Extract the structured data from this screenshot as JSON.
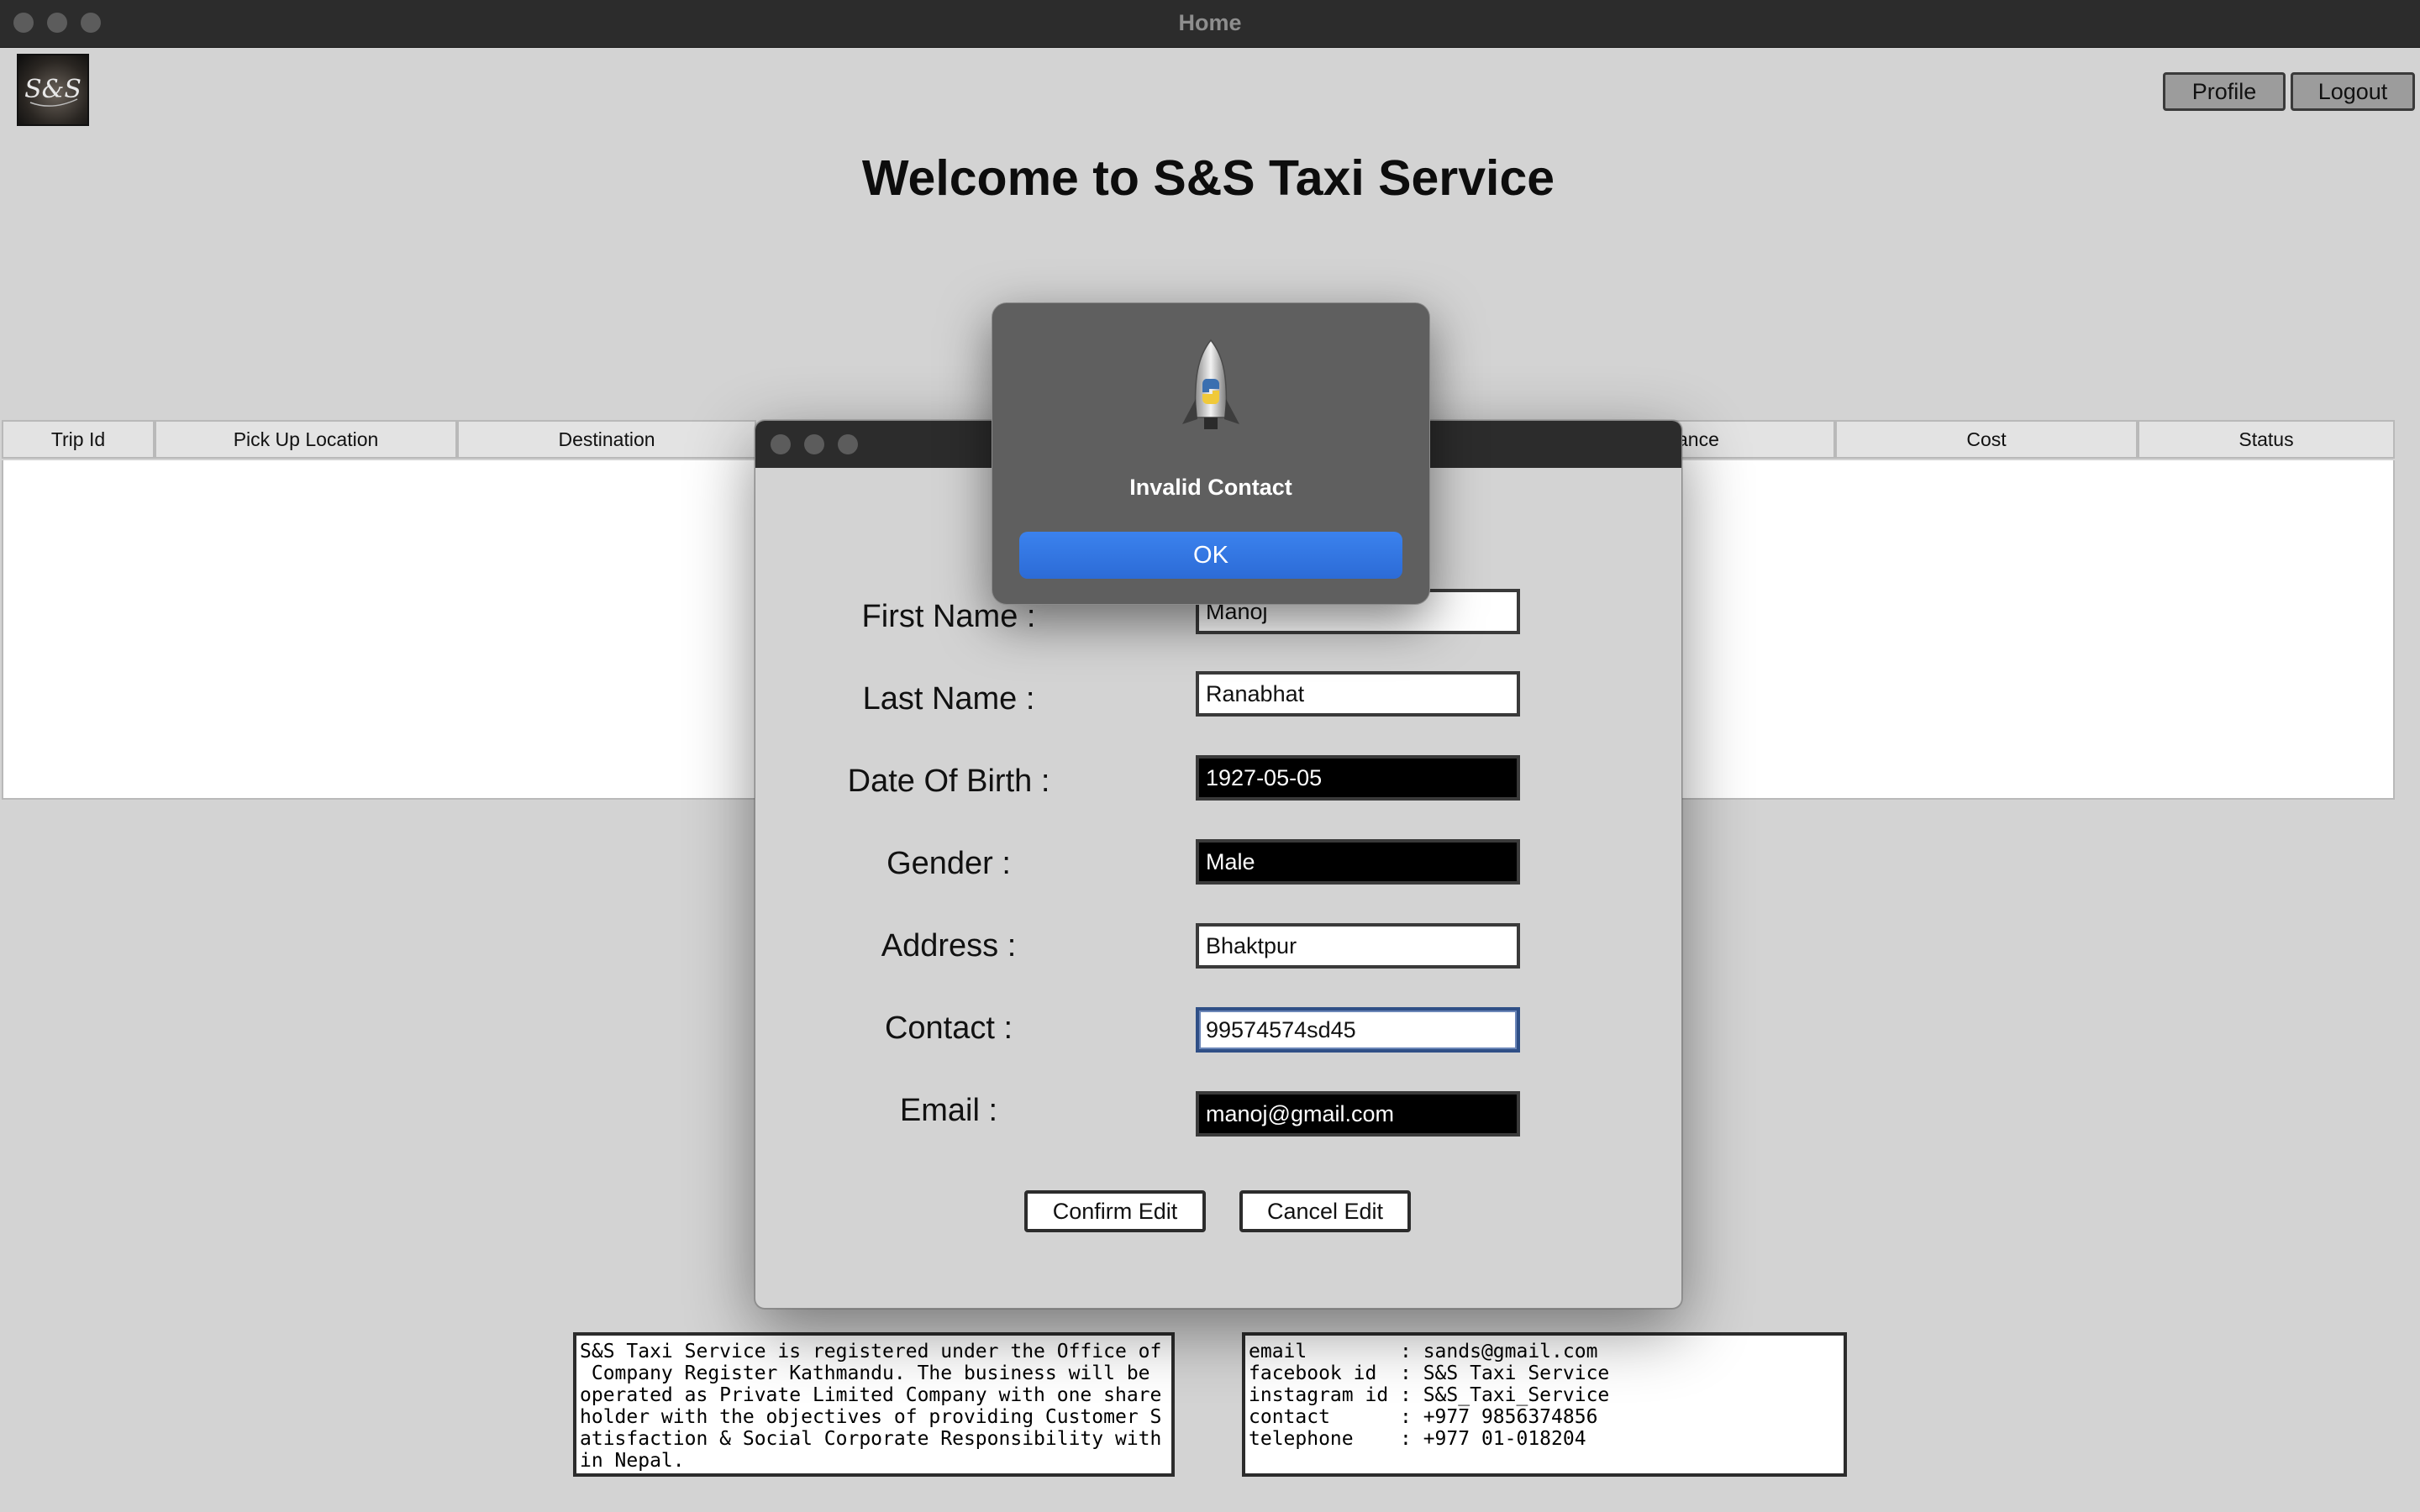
{
  "window": {
    "title": "Home"
  },
  "header": {
    "profile_label": "Profile",
    "logout_label": "Logout",
    "logo_text": "S&S"
  },
  "welcome": "Welcome to S&S Taxi Service",
  "table": {
    "columns": [
      "Trip Id",
      "Pick Up Location",
      "Destination",
      "ance",
      "Cost",
      "Status"
    ]
  },
  "footer": {
    "about_text": "S&S Taxi Service is registered under the Office of\n Company Register Kathmandu. The business will be\noperated as Private Limited Company with one share\nholder with the objectives of providing Customer S\natisfaction & Social Corporate Responsibility with\nin Nepal.",
    "contact_text": "email        : sands@gmail.com\nfacebook id  : S&S Taxi Service\ninstagram id : S&S_Taxi_Service\ncontact      : +977 9856374856\ntelephone    : +977 01-018204"
  },
  "edit_form": {
    "fields": [
      {
        "label": "First Name :",
        "value": "Manoj"
      },
      {
        "label": "Last Name :",
        "value": "Ranabhat"
      },
      {
        "label": "Date Of Birth :",
        "value": "1927-05-05"
      },
      {
        "label": "Gender :",
        "value": "Male"
      },
      {
        "label": "Address :",
        "value": "Bhaktpur"
      },
      {
        "label": "Contact :",
        "value": "99574574sd45"
      },
      {
        "label": "Email :",
        "value": "manoj@gmail.com"
      }
    ],
    "confirm_label": "Confirm Edit",
    "cancel_label": "Cancel Edit"
  },
  "alert": {
    "title": "Invalid Contact",
    "ok_label": "OK",
    "icon": "python-rocket-icon"
  },
  "colors": {
    "accent": "#2c6bd6",
    "titlebar": "#2c2c2c",
    "background": "#d3d3d3"
  }
}
